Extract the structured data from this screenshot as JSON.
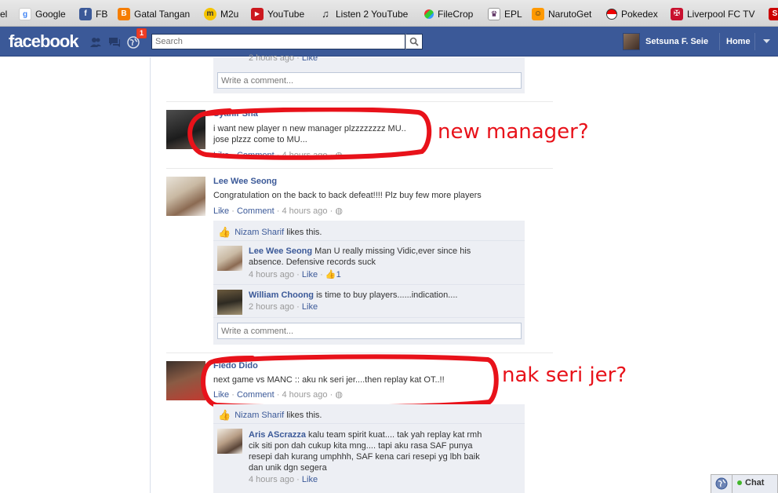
{
  "bookmarks": [
    "el",
    "Google",
    "FB",
    "Gatal Tangan",
    "M2u",
    "YouTube",
    "Listen 2 YouTube",
    "FileCrop",
    "EPL",
    "NarutoGet",
    "Pokedex",
    "Liverpool FC TV"
  ],
  "header": {
    "logo": "facebook",
    "notifications_count": "1",
    "search_placeholder": "Search",
    "profile_name": "Setsuna F. Seie",
    "home_label": "Home"
  },
  "feed": {
    "top_comment_meta_time": "2 hours ago",
    "like_label": "Like",
    "comment_label": "Comment",
    "write_comment_placeholder": "Write a comment...",
    "posts": [
      {
        "author": "Syahir Sha",
        "text_line1": "i want new player n new manager plzzzzzzzz MU..",
        "text_line2": "jose plzzz come to MU...",
        "time": "4 hours ago"
      },
      {
        "author": "Lee Wee Seong",
        "text": "Congratulation on the back to back defeat!!!! Plz buy few more players",
        "time": "4 hours ago",
        "likes_name": "Nizam Sharif",
        "likes_suffix": "likes this.",
        "comments": [
          {
            "author": "Lee Wee Seong",
            "text_line1": "Man U really missing Vidic,ever since his",
            "text_line2": "absence. Defensive records suck",
            "time": "4 hours ago",
            "like_count": "1"
          },
          {
            "author": "William Choong",
            "text": "is time to buy players......indication....",
            "time": "2 hours ago"
          }
        ]
      },
      {
        "author": "Fiedo Dido",
        "text": "next game vs MANC :: aku nk seri jer....then replay kat OT..!!",
        "time": "4 hours ago",
        "likes_name": "Nizam Sharif",
        "likes_suffix": "likes this.",
        "comments": [
          {
            "author": "Aris AScrazza",
            "text_line1": "kalu team spirit kuat.... tak yah replay kat rmh",
            "text_line2": "cik siti pon dah cukup kita mng.... tapi aku rasa SAF punya",
            "text_line3": "resepi dah kurang umphhh, SAF kena cari resepi yg lbh baik",
            "text_line4": "dan unik dgn segera",
            "time": "4 hours ago"
          }
        ]
      }
    ]
  },
  "annotations": {
    "first": "new manager?",
    "second": "nak seri jer?"
  },
  "chat": {
    "label": "Chat"
  },
  "colors": {
    "fb_blue": "#3b5998",
    "annotation_red": "#e8121a",
    "comment_bg": "#edeff4"
  }
}
